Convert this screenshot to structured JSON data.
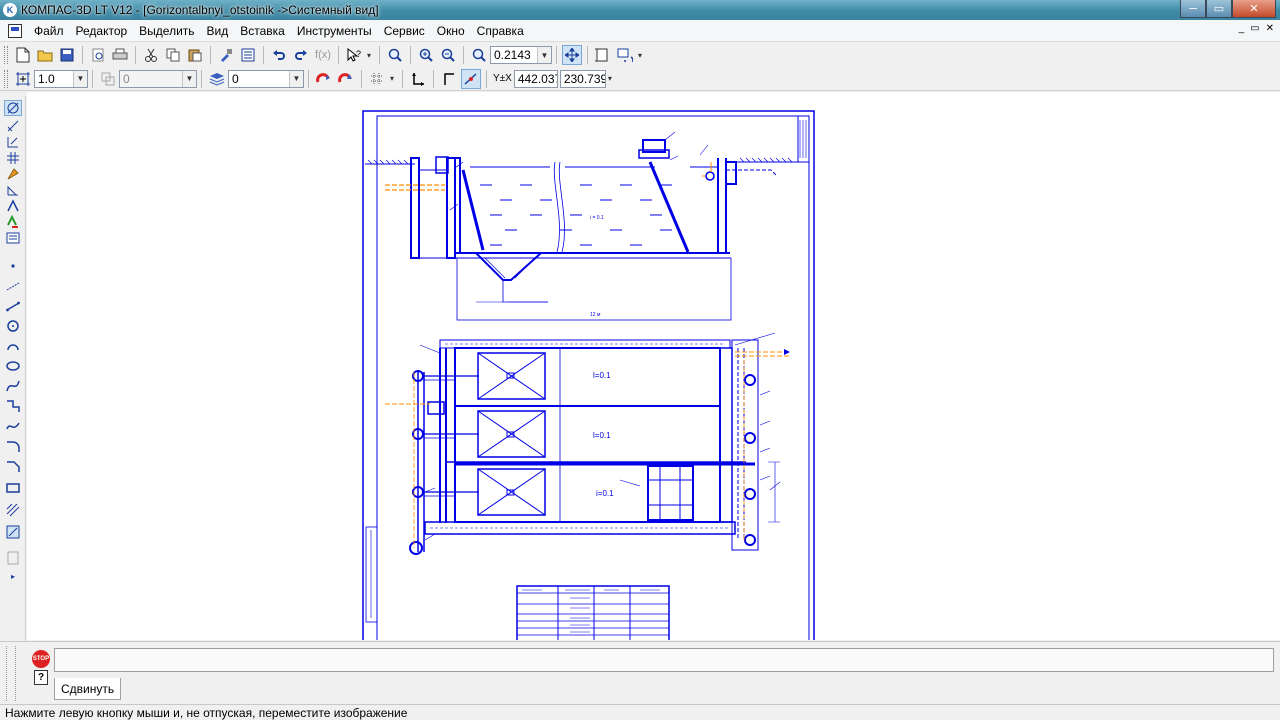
{
  "window": {
    "title": "КОМПАС-3D LT V12 - [Gorizontalbnyi_otstoinik ->Системный вид]",
    "logo_letter": "K",
    "controls": {
      "minimize": "─",
      "maximize": "▭",
      "close": "✕"
    }
  },
  "menu": {
    "items": [
      "Файл",
      "Редактор",
      "Выделить",
      "Вид",
      "Вставка",
      "Инструменты",
      "Сервис",
      "Окно",
      "Справка"
    ],
    "mdi_controls": [
      "_",
      "▭",
      "✕"
    ]
  },
  "toolbar_standard": {
    "zoom_value": "0.2143"
  },
  "toolbar_current_state": {
    "step_value": "1.0",
    "layer_value": "0",
    "style_value": "0",
    "coord_label": "Y±X",
    "coord_x": "442.037",
    "coord_y": "230.739"
  },
  "drawing": {
    "label_l": "l=0.1",
    "label_i": "i=0.1",
    "length_label": "12 м",
    "ratio_label": "i = 0.1"
  },
  "bottom_panel": {
    "stop_label": "STOP",
    "help_label": "?",
    "tab_label": "Сдвинуть"
  },
  "status": {
    "text": "Нажмите левую кнопку мыши и, не отпуская, переместите изображение"
  },
  "colors": {
    "titlebar": "#3f8aa6",
    "drawing_blue": "#0000e6",
    "drawing_orange": "#ff8c00"
  }
}
